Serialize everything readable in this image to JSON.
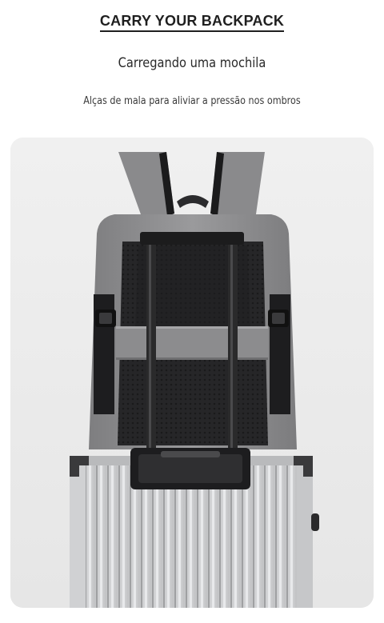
{
  "header": {
    "title": "CARRY YOUR BACKPACK",
    "subtitle": "Carregando uma mochila",
    "caption": "Alças de mala para aliviar a pressão nos ombros"
  },
  "photo": {
    "backpack_color": "#8f8f91",
    "panel_color": "#2a2a2c",
    "suitcase_color": "#c9cacc"
  }
}
